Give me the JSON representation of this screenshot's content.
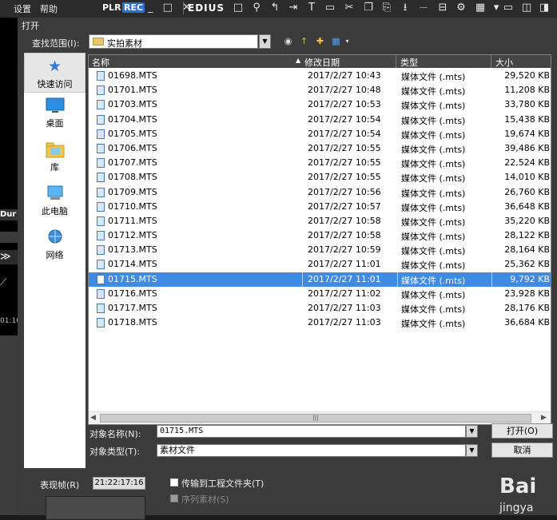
{
  "menubar": {
    "settings": "设置",
    "help": "帮助",
    "plr": "PLR",
    "rec": "REC",
    "window_controls": "_ □ ✕",
    "app_name": "EDIUS"
  },
  "timeline_side": {
    "dur_label": "Dur (",
    "timecode": "01:10"
  },
  "dialog": {
    "title": "打开",
    "look_in_label": "查找范围(I):",
    "look_in_value": "实拍素材",
    "places": [
      {
        "label": "快速访问",
        "icon": "star-icon"
      },
      {
        "label": "桌面",
        "icon": "desktop-icon"
      },
      {
        "label": "库",
        "icon": "library-icon"
      },
      {
        "label": "此电脑",
        "icon": "computer-icon"
      },
      {
        "label": "网络",
        "icon": "network-icon"
      }
    ],
    "columns": {
      "name": "名称",
      "date": "修改日期",
      "type": "类型",
      "size": "大小"
    },
    "files": [
      {
        "name": "01698.MTS",
        "date": "2017/2/27 10:43",
        "type": "媒体文件 (.mts)",
        "size": "29,520 KB"
      },
      {
        "name": "01701.MTS",
        "date": "2017/2/27 10:48",
        "type": "媒体文件 (.mts)",
        "size": "11,208 KB"
      },
      {
        "name": "01703.MTS",
        "date": "2017/2/27 10:53",
        "type": "媒体文件 (.mts)",
        "size": "33,780 KB"
      },
      {
        "name": "01704.MTS",
        "date": "2017/2/27 10:54",
        "type": "媒体文件 (.mts)",
        "size": "15,438 KB"
      },
      {
        "name": "01705.MTS",
        "date": "2017/2/27 10:54",
        "type": "媒体文件 (.mts)",
        "size": "19,674 KB"
      },
      {
        "name": "01706.MTS",
        "date": "2017/2/27 10:55",
        "type": "媒体文件 (.mts)",
        "size": "39,486 KB"
      },
      {
        "name": "01707.MTS",
        "date": "2017/2/27 10:55",
        "type": "媒体文件 (.mts)",
        "size": "22,524 KB"
      },
      {
        "name": "01708.MTS",
        "date": "2017/2/27 10:55",
        "type": "媒体文件 (.mts)",
        "size": "14,010 KB"
      },
      {
        "name": "01709.MTS",
        "date": "2017/2/27 10:56",
        "type": "媒体文件 (.mts)",
        "size": "26,760 KB"
      },
      {
        "name": "01710.MTS",
        "date": "2017/2/27 10:57",
        "type": "媒体文件 (.mts)",
        "size": "36,648 KB"
      },
      {
        "name": "01711.MTS",
        "date": "2017/2/27 10:58",
        "type": "媒体文件 (.mts)",
        "size": "35,220 KB"
      },
      {
        "name": "01712.MTS",
        "date": "2017/2/27 10:58",
        "type": "媒体文件 (.mts)",
        "size": "28,122 KB"
      },
      {
        "name": "01713.MTS",
        "date": "2017/2/27 10:59",
        "type": "媒体文件 (.mts)",
        "size": "28,164 KB"
      },
      {
        "name": "01714.MTS",
        "date": "2017/2/27 11:01",
        "type": "媒体文件 (.mts)",
        "size": "25,362 KB"
      },
      {
        "name": "01715.MTS",
        "date": "2017/2/27 11:01",
        "type": "媒体文件 (.mts)",
        "size": "9,792 KB",
        "selected": true
      },
      {
        "name": "01716.MTS",
        "date": "2017/2/27 11:02",
        "type": "媒体文件 (.mts)",
        "size": "23,928 KB"
      },
      {
        "name": "01717.MTS",
        "date": "2017/2/27 11:03",
        "type": "媒体文件 (.mts)",
        "size": "28,176 KB"
      },
      {
        "name": "01718.MTS",
        "date": "2017/2/27 11:03",
        "type": "媒体文件 (.mts)",
        "size": "36,684 KB"
      }
    ],
    "filename_label": "对象名称(N):",
    "filename_value": "01715.MTS",
    "filetype_label": "对象类型(T):",
    "filetype_value": "素材文件",
    "open_button": "打开(O)",
    "cancel_button": "取消",
    "duration_label": "表现帧(R)",
    "duration_value": "21:22:17:16",
    "copy_to_project_label": "传输到工程文件夹(T)",
    "sequence_clip_label": "序列素材(S)"
  },
  "watermark": {
    "line1": "Bai",
    "line2": "jingya"
  },
  "colors": {
    "selection": "#3d8be4",
    "dialog_bg": "#3b3b3b",
    "header_bg": "#454545",
    "rec_accent": "#2d6fd6"
  }
}
